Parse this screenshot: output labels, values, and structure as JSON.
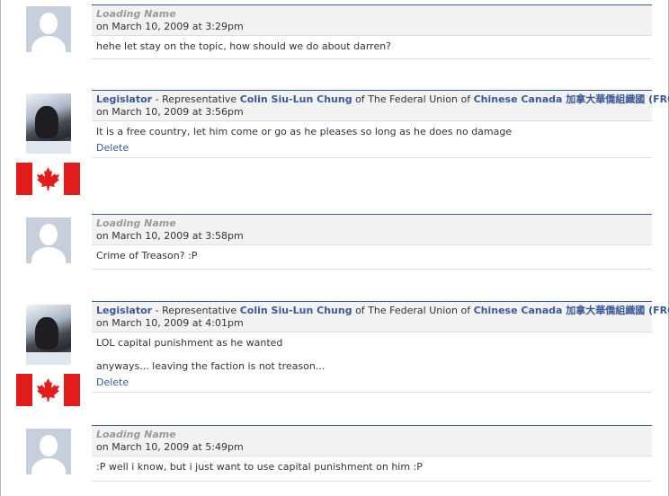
{
  "posts": [
    {
      "type": "anonymous",
      "name": "Loading Name",
      "date": "on March 10, 2009 at 3:29pm",
      "body": [
        "hehe let stay on the topic, how should we do about darren?"
      ]
    },
    {
      "type": "legislator",
      "name": "Legislator",
      "separator": " - ",
      "role": "Representative ",
      "person": "Colin Siu-Lun Chung",
      "of1": " of ",
      "union": "The Federal Union of",
      "org": "Chinese Canada 加拿大華僑組織國 (FRC)",
      "date": "on March 10, 2009 at 3:56pm",
      "body": [
        "It is a free country, let him come or go as he pleases so long as he does no damage"
      ],
      "delete": "Delete"
    },
    {
      "type": "anonymous",
      "name": "Loading Name",
      "date": "on March 10, 2009 at 3:58pm",
      "body": [
        "Crime of Treason? :P"
      ]
    },
    {
      "type": "legislator",
      "name": "Legislator",
      "separator": " - ",
      "role": "Representative ",
      "person": "Colin Siu-Lun Chung",
      "of1": " of ",
      "union": "The Federal Union of",
      "org": "Chinese Canada 加拿大華僑組織國 (FRC)",
      "date": "on March 10, 2009 at 4:01pm",
      "body": [
        "LOL capital punishment as he wanted",
        "anyways... leaving the faction is not treason..."
      ],
      "delete": "Delete"
    },
    {
      "type": "anonymous",
      "name": "Loading Name",
      "date": "on March 10, 2009 at 5:49pm",
      "body": [
        ":P well i know, but i just want to use capital punishment on him :P"
      ]
    }
  ],
  "colors": {
    "link_blue": "#3b5998",
    "header_bg": "#f2f2f2",
    "flag_red": "#e21b1b",
    "avatar_placeholder": "#c7cfdc"
  },
  "icons": {
    "anonymous_avatar": "silhouette-icon",
    "flag": "canada-flag-icon"
  }
}
